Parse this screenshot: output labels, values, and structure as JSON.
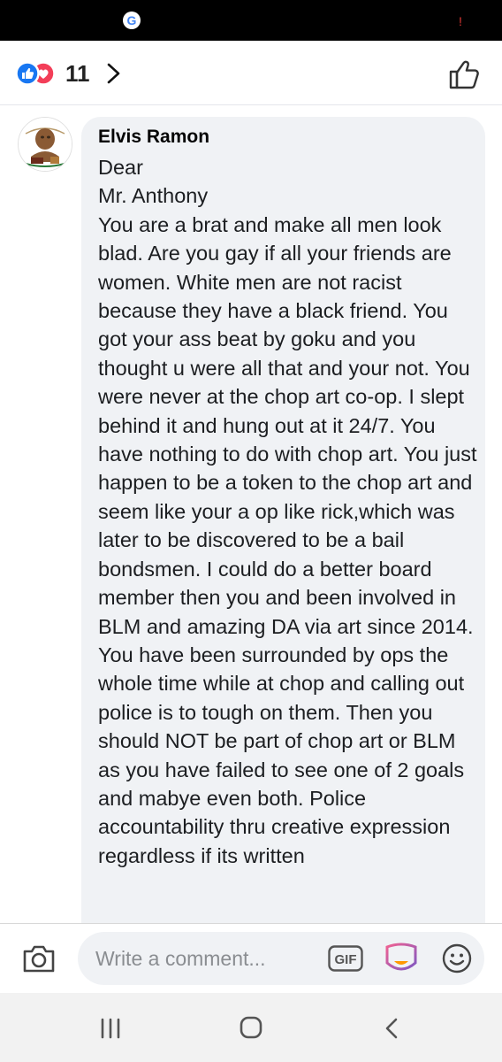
{
  "reactions": {
    "count": "11",
    "icons": [
      "like-icon",
      "love-icon"
    ]
  },
  "comment": {
    "author": "Elvis Ramon",
    "text": "Dear\nMr. Anthony\nYou are a brat and make all men look blad. Are you gay if all your friends are women. White men are not racist because  they have a black friend. You got your ass beat by goku  and you thought u were all that and your not. You were never at the chop art co-op. I slept behind it and hung  out at it 24/7. You have nothing to do with chop art. You just happen to be a token to the chop art and seem like your a op like rick,which was later to be discovered to be a bail bondsmen. I could do a better board member then you and been involved in BLM and amazing  DA via art since  2014. You have been surrounded by ops the whole time while at chop and calling out police is to tough on them. Then you should NOT be part of chop art or BLM  as you have failed to see one of 2 goals and mabye  even both.  Police accountability  thru creative expression regardless  if its written"
  },
  "composer": {
    "placeholder": "Write a comment...",
    "gif_label": "GIF"
  },
  "status_bar": {
    "app_icon": "G"
  },
  "colors": {
    "like_blue": "#1877f2",
    "love_red": "#f33e58",
    "bubble": "#f0f2f5"
  }
}
